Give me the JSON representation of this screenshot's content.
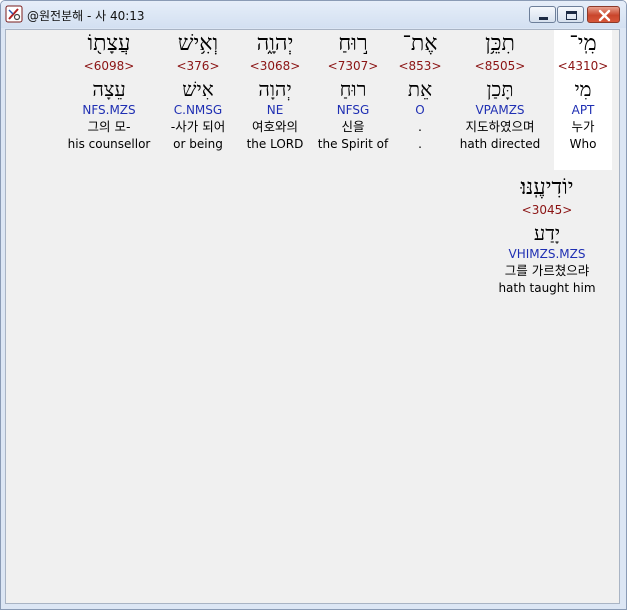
{
  "window": {
    "title": "@원전분해 - 사 40:13",
    "controls": {
      "minimize": "minimize",
      "maximize": "maximize",
      "close": "close"
    }
  },
  "rows": [
    {
      "words": [
        {
          "hebrew": "מִֽי־",
          "strong": "<4310>",
          "lemma": "מִי",
          "morph": "APT",
          "korean": "누가",
          "english": "Who",
          "selected": true
        },
        {
          "hebrew": "תִכֵּ֥ן",
          "strong": "<8505>",
          "lemma": "תָּכַן",
          "morph": "VPAMZS",
          "korean": "지도하였으며",
          "english": "hath directed",
          "selected": false
        },
        {
          "hebrew": "אֶת־",
          "strong": "<853>",
          "lemma": "אֵת",
          "morph": "O",
          "korean": ".",
          "english": ".",
          "selected": false
        },
        {
          "hebrew": "ר֣וּחַ",
          "strong": "<7307>",
          "lemma": "רוּחַ",
          "morph": "NFSG",
          "korean": "신을",
          "english": "the Spirit of",
          "selected": false
        },
        {
          "hebrew": "יְהוָ֑ה",
          "strong": "<3068>",
          "lemma": "יְהוָה",
          "morph": "NE",
          "korean": "여호와의",
          "english": "the LORD",
          "selected": false
        },
        {
          "hebrew": "וְאִ֥ישׁ",
          "strong": "<376>",
          "lemma": "אִישׁ",
          "morph": "C.NMSG",
          "korean": "-사가 되어",
          "english": "or being",
          "selected": false
        },
        {
          "hebrew": "עֲצָת֖וֹ",
          "strong": "<6098>",
          "lemma": "עֵצָה",
          "morph": "NFS.MZS",
          "korean": "그의 모-",
          "english": "his counsellor",
          "selected": false
        }
      ]
    },
    {
      "words": [
        {
          "hebrew": "יוֹדִיעֶֽנּוּ׃",
          "strong": "<3045>",
          "lemma": "יָדַע",
          "morph": "VHIMZS.MZS",
          "korean": "그를 가르쳤으랴",
          "english": "hath taught him",
          "selected": false
        }
      ]
    }
  ]
}
